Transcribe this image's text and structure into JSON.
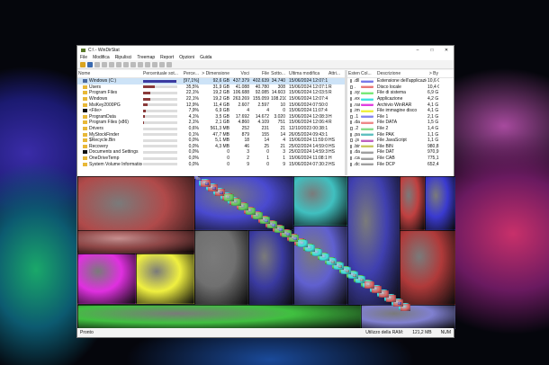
{
  "title": "C:\\ - WinDirStat",
  "window_controls": [
    "–",
    "□",
    "✕"
  ],
  "menu": [
    "File",
    "Modifica",
    "Ripulisci",
    "Treemap",
    "Report",
    "Opzioni",
    "Guida"
  ],
  "tree": {
    "headers": [
      "Nome",
      "Percentuale sot...",
      "Perce...",
      "> Dimensione",
      "Voci",
      "File",
      "Sotto...",
      "Ultima modifica",
      "Attri..."
    ],
    "rows": [
      {
        "name": "Windows (C:)",
        "bar": 97,
        "pct": "[97,1%]",
        "size": "92,6 GB",
        "items": "437.379",
        "files": "402.639",
        "sub": "34.740",
        "mod": "15/06/2024 12:07:17",
        "attr": "",
        "icon": "drive"
      },
      {
        "name": "Users",
        "bar": 35,
        "pct": "35,5%",
        "size": "31,9 GB",
        "items": "41.088",
        "files": "40.780",
        "sub": "308",
        "mod": "15/06/2024 12:07:17",
        "attr": "R",
        "icon": "folder"
      },
      {
        "name": "Program Files",
        "bar": 22,
        "pct": "22,1%",
        "size": "19,2 GB",
        "items": "106.688",
        "files": "92.085",
        "sub": "14.603",
        "mod": "15/06/2024 12:03:59",
        "attr": "R",
        "icon": "folder"
      },
      {
        "name": "Windows",
        "bar": 22,
        "pct": "22,1%",
        "size": "19,2 GB",
        "items": "263.269",
        "files": "155.059",
        "sub": "108.210",
        "mod": "15/06/2024 12:07:42",
        "attr": "",
        "icon": "folder"
      },
      {
        "name": "MsiKey2000PG",
        "bar": 13,
        "pct": "12,9%",
        "size": "11,4 GB",
        "items": "2.607",
        "files": "2.597",
        "sub": "10",
        "mod": "15/06/2024 07:50:00",
        "attr": "",
        "icon": "folder"
      },
      {
        "name": "<File>",
        "bar": 8,
        "pct": "7,9%",
        "size": "6,9 GB",
        "items": "4",
        "files": "4",
        "sub": "0",
        "mod": "15/06/2024 11:07:42",
        "attr": "",
        "icon": "dark"
      },
      {
        "name": "ProgramData",
        "bar": 4,
        "pct": "4,1%",
        "size": "3,5 GB",
        "items": "17.692",
        "files": "14.672",
        "sub": "3.020",
        "mod": "15/06/2024 12:08:32",
        "attr": "H",
        "icon": "folder"
      },
      {
        "name": "Program Files (x86)",
        "bar": 2,
        "pct": "2,1%",
        "size": "2,1 GB",
        "items": "4.860",
        "files": "4.109",
        "sub": "751",
        "mod": "15/06/2024 12:06:48",
        "attr": "R",
        "icon": "folder"
      },
      {
        "name": "Drivers",
        "bar": 0,
        "pct": "0,6%",
        "size": "561,3 MB",
        "items": "252",
        "files": "231",
        "sub": "21",
        "mod": "12/10/2023 00:38:13",
        "attr": "",
        "icon": "folder"
      },
      {
        "name": "MyStockFinder",
        "bar": 0,
        "pct": "0,1%",
        "size": "47,7 MB",
        "items": "879",
        "files": "155",
        "sub": "14",
        "mod": "26/05/2024 09:43:18",
        "attr": "",
        "icon": "folder"
      },
      {
        "name": "$Recycle.Bin",
        "bar": 0,
        "pct": "0,0%",
        "size": "5,1 MB",
        "items": "18",
        "files": "14",
        "sub": "4",
        "mod": "15/06/2024 11:59:04",
        "attr": "HS",
        "icon": "folder"
      },
      {
        "name": "Recovery",
        "bar": 0,
        "pct": "0,0%",
        "size": "4,3 MB",
        "items": "46",
        "files": "25",
        "sub": "21",
        "mod": "25/02/2024 14:59:06",
        "attr": "HS",
        "icon": "folder"
      },
      {
        "name": "Documents and Settings",
        "bar": 0,
        "pct": "0,0%",
        "size": "0",
        "items": "3",
        "files": "0",
        "sub": "3",
        "mod": "25/02/2024 14:59:34",
        "attr": "HS",
        "icon": "dark"
      },
      {
        "name": "OneDriveTemp",
        "bar": 0,
        "pct": "0,0%",
        "size": "0",
        "items": "2",
        "files": "1",
        "sub": "1",
        "mod": "15/06/2024 11:08:15",
        "attr": "H",
        "icon": "folder"
      },
      {
        "name": "System Volume Information",
        "bar": 0,
        "pct": "0,0%",
        "size": "0",
        "items": "9",
        "files": "0",
        "sub": "9",
        "mod": "15/06/2024 07:30:27",
        "attr": "HS",
        "icon": "folder"
      }
    ]
  },
  "ext": {
    "headers": [
      "Estensi...",
      "Col...",
      "Descrizione",
      "> By"
    ],
    "rows": [
      {
        "ext": ".dll",
        "color": "#7878e8",
        "desc": "Estensione dell'applicazione",
        "size": "10,6 G"
      },
      {
        "ext": ".",
        "color": "#e87878",
        "desc": "Disco locale",
        "size": "10,4 G"
      },
      {
        "ext": ".sys",
        "color": "#78e878",
        "desc": "File di sistema",
        "size": "6,9 G"
      },
      {
        "ext": ".exe",
        "color": "#40e0e0",
        "desc": "Applicazione",
        "size": "4,2 G"
      },
      {
        "ext": ".rar",
        "color": "#e040e0",
        "desc": "Archivio WinRAR",
        "size": "4,1 G"
      },
      {
        "ext": ".img",
        "color": "#f0f040",
        "desc": "File immagine disco",
        "size": "4,1 G"
      },
      {
        "ext": ".1",
        "color": "#8888ee",
        "desc": "File 1",
        "size": "2,1 G"
      },
      {
        "ext": ".data",
        "color": "#ee8888",
        "desc": "File DATA",
        "size": "1,5 G"
      },
      {
        "ext": ".2",
        "color": "#88dd88",
        "desc": "File 2",
        "size": "1,4 G"
      },
      {
        "ext": ".pak",
        "color": "#60c0c0",
        "desc": "File PAK",
        "size": "1,1 G"
      },
      {
        "ext": ".js",
        "color": "#c060c0",
        "desc": "File JavaScript",
        "size": "1,1 G"
      },
      {
        "ext": ".bin",
        "color": "#c8c860",
        "desc": "File BIN",
        "size": "980,8 M"
      },
      {
        "ext": ".dat",
        "color": "#a0a0a0",
        "desc": "File DAT",
        "size": "970,9 M"
      },
      {
        "ext": ".cab",
        "color": "#a0a0a0",
        "desc": "File CAB",
        "size": "775,1 M"
      },
      {
        "ext": ".dcp",
        "color": "#a0a0a0",
        "desc": "File DCP",
        "size": "652,4 M"
      }
    ]
  },
  "status": {
    "left": "Pronto",
    "ram": "Utilizzo della RAM:",
    "ram_val": "121,2 MB",
    "num": "NUM"
  }
}
